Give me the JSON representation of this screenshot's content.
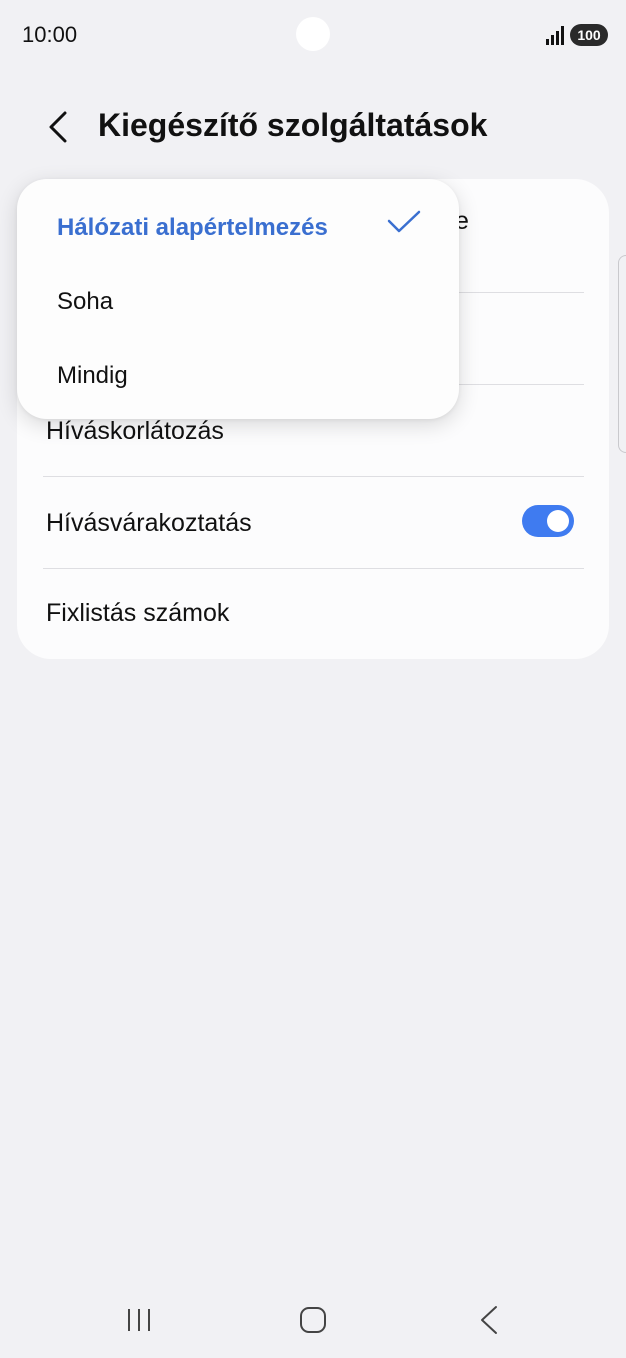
{
  "status_bar": {
    "time": "10:00",
    "battery": "100",
    "icons": [
      "signal-icon",
      "battery-icon"
    ]
  },
  "header": {
    "title": "Kiegészítő szolgáltatások",
    "back_icon": "chevron-left-icon"
  },
  "settings": {
    "items": [
      {
        "label": "",
        "partial_visible": "e"
      },
      {
        "label": ""
      },
      {
        "label": "Híváskorlátozás"
      },
      {
        "label": "Hívásvárakoztatás",
        "toggle_on": true
      },
      {
        "label": "Fixlistás számok"
      }
    ]
  },
  "dropdown": {
    "options": [
      {
        "label": "Hálózati alapértelmezés",
        "selected": true
      },
      {
        "label": "Soha",
        "selected": false
      },
      {
        "label": "Mindig",
        "selected": false
      }
    ]
  },
  "colors": {
    "accent": "#3a6fd0",
    "toggle": "#3f7bf0",
    "background": "#f1f1f4",
    "card": "#fcfcfd"
  },
  "nav_bar": {
    "icons": [
      "recents-icon",
      "home-icon",
      "back-icon"
    ]
  }
}
